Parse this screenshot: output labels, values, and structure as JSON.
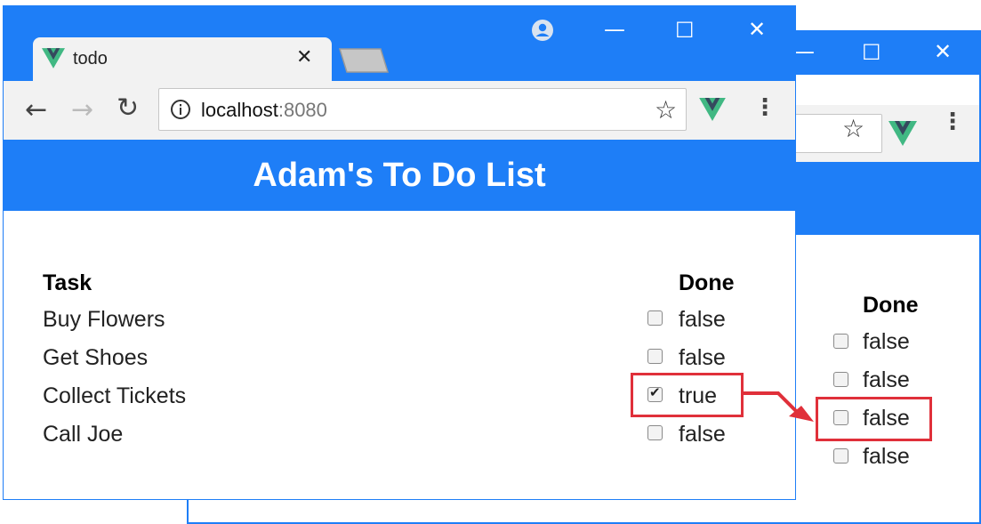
{
  "front_window": {
    "tab_title": "todo",
    "url_host": "localhost",
    "url_port": ":8080",
    "app_title": "Adam's To Do List",
    "task_header": "Task",
    "done_header": "Done",
    "rows": [
      {
        "task": "Buy Flowers",
        "done": "false",
        "checked": false
      },
      {
        "task": "Get Shoes",
        "done": "false",
        "checked": false
      },
      {
        "task": "Collect Tickets",
        "done": "true",
        "checked": true
      },
      {
        "task": "Call Joe",
        "done": "false",
        "checked": false
      }
    ]
  },
  "back_window": {
    "done_header": "Done",
    "rows": [
      {
        "done": "false",
        "checked": false
      },
      {
        "done": "false",
        "checked": false
      },
      {
        "done": "false",
        "checked": false
      },
      {
        "done": "false",
        "checked": false
      }
    ]
  },
  "colors": {
    "brand_blue": "#1e7ef7",
    "highlight_red": "#e0303a",
    "vue_green": "#41b883",
    "vue_dark": "#35495e"
  },
  "icons": {
    "favicon": "vue-logo-icon",
    "extension": "vue-devtools-icon",
    "arrow": "red-arrow-icon"
  }
}
